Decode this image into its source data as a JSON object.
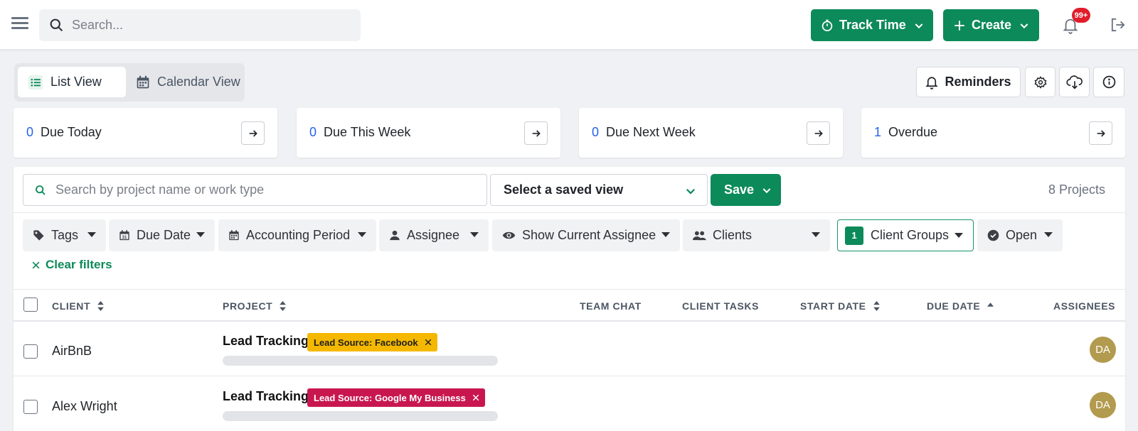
{
  "topbar": {
    "search_placeholder": "Search...",
    "track_time_label": "Track Time",
    "create_label": "Create",
    "notification_count": "99+"
  },
  "views": {
    "list_label": "List View",
    "calendar_label": "Calendar View",
    "active": "List View"
  },
  "tools": {
    "reminders_label": "Reminders"
  },
  "stats": [
    {
      "count": "0",
      "label": "Due Today"
    },
    {
      "count": "0",
      "label": "Due This Week"
    },
    {
      "count": "0",
      "label": "Due Next Week"
    },
    {
      "count": "1",
      "label": "Overdue"
    }
  ],
  "panel": {
    "search_placeholder": "Search by project name or work type",
    "saved_view_label": "Select a saved view",
    "save_label": "Save",
    "project_count": "8 Projects",
    "clear_filters_label": "Clear filters"
  },
  "filters": [
    {
      "label": "Tags",
      "icon": "tag-icon"
    },
    {
      "label": "Due Date",
      "icon": "calendar-icon"
    },
    {
      "label": "Accounting Period",
      "icon": "calendar-icon"
    },
    {
      "label": "Assignee",
      "icon": "person-icon"
    },
    {
      "label": "Show Current Assignee",
      "icon": "eye-icon"
    },
    {
      "label": "Clients",
      "icon": "people-icon"
    },
    {
      "label": "Client Groups",
      "count": "1"
    },
    {
      "label": "Open",
      "icon": "check-circle-icon"
    }
  ],
  "columns": {
    "client": "CLIENT",
    "project": "PROJECT",
    "team_chat": "TEAM CHAT",
    "client_tasks": "CLIENT TASKS",
    "start_date": "START DATE",
    "due_date": "DUE DATE",
    "assignees": "ASSIGNEES"
  },
  "rows": [
    {
      "client": "AirBnB",
      "project": "Lead Tracking",
      "tag": "Lead Source: Facebook",
      "tag_color": "#f5b800",
      "assignee": "DA"
    },
    {
      "client": "Alex Wright",
      "project": "Lead Tracking",
      "tag": "Lead Source: Google My Business",
      "tag_color": "#c8174f",
      "assignee": "DA"
    }
  ],
  "colors": {
    "brand_green": "#0d8a5a",
    "count_blue": "#2463eb",
    "avatar": "#b29a4e"
  }
}
